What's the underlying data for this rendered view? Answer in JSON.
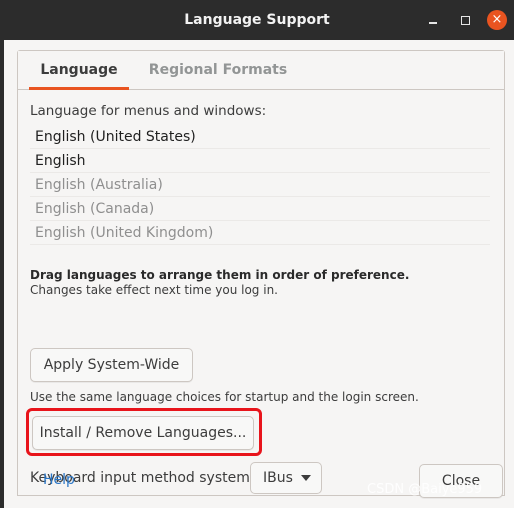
{
  "window": {
    "title": "Language Support",
    "controls": {
      "minimize": "minimize",
      "maximize": "maximize",
      "close": "×"
    }
  },
  "tabs": [
    {
      "label": "Language",
      "active": true
    },
    {
      "label": "Regional Formats",
      "active": false
    }
  ],
  "language_section": {
    "heading": "Language for menus and windows:",
    "languages": [
      {
        "name": "English (United States)",
        "active": true
      },
      {
        "name": "English",
        "active": true
      },
      {
        "name": "English (Australia)",
        "active": false
      },
      {
        "name": "English (Canada)",
        "active": false
      },
      {
        "name": "English (United Kingdom)",
        "active": false
      }
    ],
    "drag_hint": "Drag languages to arrange them in order of preference.",
    "effect_hint": "Changes take effect next time you log in.",
    "apply_button": "Apply System-Wide",
    "apply_hint": "Use the same language choices for startup and the login screen.",
    "install_button": "Install / Remove Languages...",
    "keyboard_label": "Keyboard input method system:",
    "keyboard_value": "IBus"
  },
  "footer": {
    "help": "Help",
    "close": "Close"
  },
  "watermark": "CSDN @Baiye959",
  "colors": {
    "accent": "#e95420",
    "highlight_box": "#e8141b",
    "link": "#2a76c6",
    "titlebar": "#2c2c2c"
  }
}
